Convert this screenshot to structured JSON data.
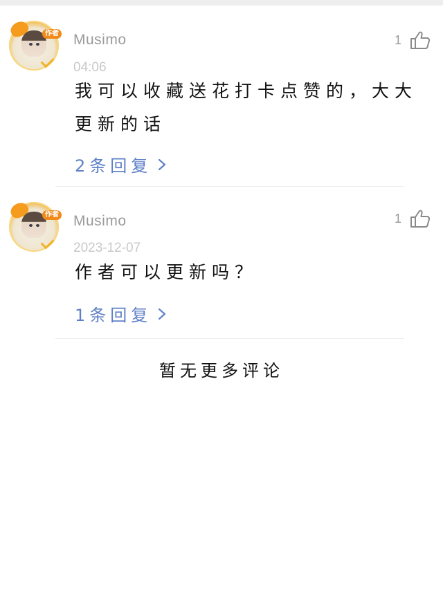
{
  "comments": [
    {
      "username": "Musimo",
      "avatar_badge": "作者",
      "time": "04:06",
      "likes": "1",
      "text": "我可以收藏送花打卡点赞的，大大更新的话",
      "replies": "2条回复"
    },
    {
      "username": "Musimo",
      "avatar_badge": "作者",
      "time": "2023-12-07",
      "likes": "1",
      "text": "作者可以更新吗？",
      "replies": "1条回复"
    }
  ],
  "footer": {
    "no_more": "暂无更多评论"
  },
  "icons": {
    "like": "thumbs-up-icon",
    "chevron": "chevron-right-icon",
    "avatar_check": "check-icon"
  },
  "colors": {
    "reply_link": "#5d80c7",
    "meta_text": "#9a9a9a",
    "badge": "#f08a1a"
  }
}
